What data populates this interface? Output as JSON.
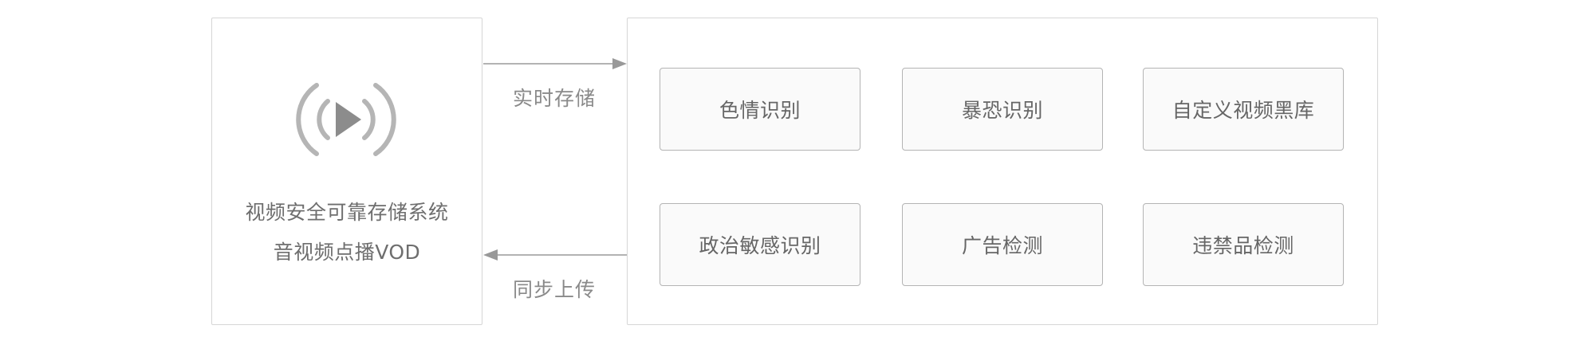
{
  "source": {
    "title_line_1": "视频安全可靠存储系统",
    "title_line_2": "音视频点播VOD",
    "icon": "play-broadcast-icon"
  },
  "arrows": {
    "upload_label": "实时存储",
    "sync_label": "同步上传"
  },
  "features": [
    "色情识别",
    "暴恐识别",
    "自定义视频黑库",
    "政治敏感识别",
    "广告检测",
    "违禁品检测"
  ],
  "colors": {
    "panel_border": "#d6d6d6",
    "box_border": "#b4b4b4",
    "box_fill": "#fafafa",
    "icon": "#8c8c8c",
    "arrow": "#999999",
    "text": "#666666"
  }
}
